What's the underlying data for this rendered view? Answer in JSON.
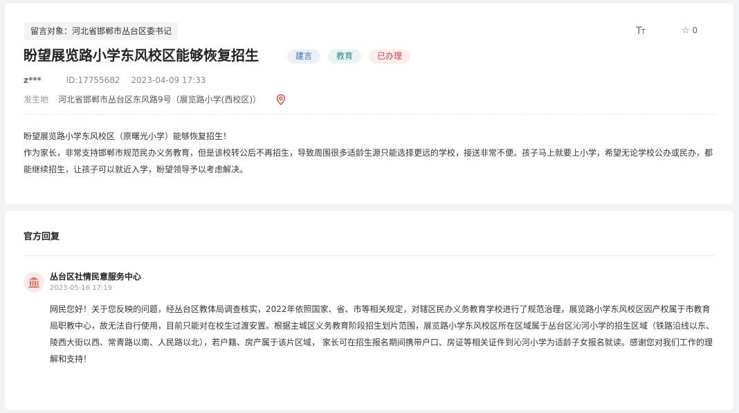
{
  "message": {
    "target_label": "留言对象：河北省邯郸市丛台区委书记",
    "title": "盼望展览路小学东风校区能够恢复招生",
    "tags": [
      {
        "label": "建言",
        "color": "#3d6fb0"
      },
      {
        "label": "教育",
        "color": "#2f8c83"
      },
      {
        "label": "已办理",
        "color": "#d6455a"
      }
    ],
    "font_toggle": "Tт",
    "favorite_count": "0",
    "author": "z***",
    "id_text": "ID:17755682",
    "datetime": "2023-04-09 17:33",
    "location_label": "发生地",
    "location": "河北省邯郸市丛台区东风路9号（展览路小学(西校区)）",
    "content_lines": [
      "盼望展览路小学东风校区（原曙光小学）能够恢复招生！",
      "作为家长，非常支持邯郸市规范民办义务教育，但是该校转公后不再招生，导致周围很多适龄生源只能选择更远的学校，接送非常不便。孩子马上就要上小学，希望无论学校公办或民办，都能继续招生，让孩子可以就近入学，盼望领导予以考虑解决。"
    ]
  },
  "reply": {
    "header": "官方回复",
    "department": "丛台区社情民意服务中心",
    "datetime": "2023-05-16 17:19",
    "content": "网民您好！关于您反映的问题，经丛台区教体局调查核实，2022年依照国家、省、市等相关规定，对辖区民办义务教育学校进行了规范治理，展览路小学东风校区因产权属于市教育局职教中心，故无法自行使用，目前只能对在校生过渡安置。根据主城区义务教育阶段招生划片范围，展览路小学东风校区所在区域属于丛台区沁河小学的招生区域（铁路沿线以东、陵西大街以西、常青路以南、人民路以北），若户籍、房产属于该片区域， 家长可在招生报名期间携带户口、房证等相关证件到沁河小学为适龄子女报名就读。感谢您对我们工作的理解和支持！"
  },
  "icons": {
    "star": "star-outline-icon",
    "pin": "location-pin-icon",
    "dept": "government-building-icon"
  }
}
